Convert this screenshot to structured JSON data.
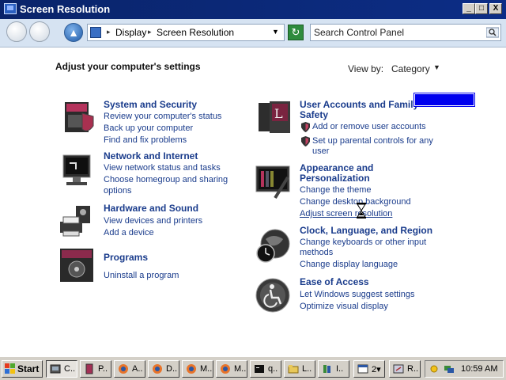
{
  "window": {
    "title": "Screen Resolution",
    "min_label": "_",
    "max_label": "□",
    "close_label": "X"
  },
  "addressbar": {
    "breadcrumb": [
      "Display",
      "Screen Resolution"
    ],
    "search_placeholder": "Search Control Panel"
  },
  "main": {
    "heading": "Adjust your computer's settings",
    "view_by_label": "View by:",
    "view_by_value": "Category"
  },
  "categories_left": [
    {
      "title": "System and Security",
      "links": [
        "Review your computer's status",
        "Back up your computer",
        "Find and fix problems"
      ]
    },
    {
      "title": "Network and Internet",
      "links": [
        "View network status and tasks",
        "Choose homegroup and sharing",
        "options"
      ]
    },
    {
      "title": "Hardware and Sound",
      "links": [
        "View devices and printers",
        "Add a device"
      ]
    },
    {
      "title": "Programs",
      "links": [
        "Uninstall a program"
      ]
    }
  ],
  "categories_right": [
    {
      "title": [
        "User Accounts and Family",
        "Safety"
      ],
      "links": [
        "Add or remove user accounts",
        "Set up parental controls for any",
        "user"
      ]
    },
    {
      "title": [
        "Appearance and",
        "Personalization"
      ],
      "links": [
        "Change the theme",
        "Change desktop background",
        "Adjust screen resolution"
      ]
    },
    {
      "title": [
        "Clock, Language, and Region"
      ],
      "links": [
        "Change keyboards or other input",
        "methods",
        "Change display language"
      ]
    },
    {
      "title": [
        "Ease of Access"
      ],
      "links": [
        "Let Windows suggest settings",
        "Optimize visual display"
      ]
    }
  ],
  "taskbar": {
    "start_label": "Start",
    "tasks": [
      {
        "label": "C..",
        "icon": "control-panel-icon",
        "active": true
      },
      {
        "label": "P..",
        "icon": "document-icon",
        "active": false
      },
      {
        "label": "A..",
        "icon": "firefox-icon",
        "active": false
      },
      {
        "label": "D..",
        "icon": "firefox-icon",
        "active": false
      },
      {
        "label": "M..",
        "icon": "firefox-icon",
        "active": false
      },
      {
        "label": "M..",
        "icon": "firefox-icon",
        "active": false
      },
      {
        "label": "q..",
        "icon": "terminal-icon",
        "active": false
      },
      {
        "label": "L..",
        "icon": "folder-icon",
        "active": false
      },
      {
        "label": "I..",
        "icon": "books-icon",
        "active": false
      },
      {
        "label": "2▾",
        "icon": "window-icon",
        "active": false
      },
      {
        "label": "R..",
        "icon": "remote-icon",
        "active": false
      }
    ],
    "clock": "10:59 AM"
  },
  "colors": {
    "titlebar": "#0a246a",
    "link_blue": "#1a3c8c",
    "taskbar": "#d4d0c8"
  }
}
